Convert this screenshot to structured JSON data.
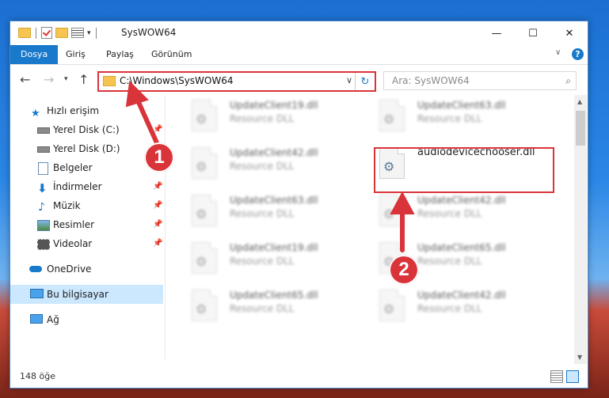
{
  "window": {
    "title": "SysWOW64"
  },
  "window_controls": {
    "minimize": "—",
    "maximize": "☐",
    "close": "✕"
  },
  "ribbon": {
    "tabs": [
      "Dosya",
      "Giriş",
      "Paylaş",
      "Görünüm"
    ],
    "expand": "∨",
    "help": "?"
  },
  "address": {
    "path": "C:\\Windows\\SysWOW64"
  },
  "search": {
    "placeholder": "Ara: SysWOW64"
  },
  "sidebar": {
    "items": [
      {
        "label": "Hızlı erişim",
        "icon": "star-icon"
      },
      {
        "label": "Yerel Disk (C:)",
        "icon": "drive-icon"
      },
      {
        "label": "Yerel Disk (D:)",
        "icon": "drive-icon"
      },
      {
        "label": "Belgeler",
        "icon": "documents-icon"
      },
      {
        "label": "İndirmeler",
        "icon": "download-icon"
      },
      {
        "label": "Müzik",
        "icon": "music-icon"
      },
      {
        "label": "Resimler",
        "icon": "pictures-icon"
      },
      {
        "label": "Videolar",
        "icon": "video-icon"
      },
      {
        "label": "OneDrive",
        "icon": "cloud-icon"
      },
      {
        "label": "Bu bilgisayar",
        "icon": "computer-icon"
      },
      {
        "label": "Ağ",
        "icon": "network-icon"
      }
    ]
  },
  "files": [
    {
      "name": "UpdateClient19.dll",
      "type": "Resource DLL"
    },
    {
      "name": "UpdateClient63.dll",
      "type": "Resource DLL"
    },
    {
      "name": "UpdateClient42.dll",
      "type": "Resource DLL"
    },
    {
      "name": "audiodevicechooser.dll",
      "type": ""
    },
    {
      "name": "UpdateClient63.dll",
      "type": "Resource DLL"
    },
    {
      "name": "UpdateClient42.dll",
      "type": "Resource DLL"
    },
    {
      "name": "UpdateClient19.dll",
      "type": "Resource DLL"
    },
    {
      "name": "UpdateClient65.dll",
      "type": "Resource DLL"
    },
    {
      "name": "UpdateClient65.dll",
      "type": "Resource DLL"
    },
    {
      "name": "UpdateClient42.dll",
      "type": "Resource DLL"
    }
  ],
  "status": {
    "count": "148 öğe"
  },
  "callouts": [
    "1",
    "2"
  ],
  "colors": {
    "accent": "#1979ca",
    "highlight": "#d9343a",
    "selected": "#cce8ff"
  }
}
